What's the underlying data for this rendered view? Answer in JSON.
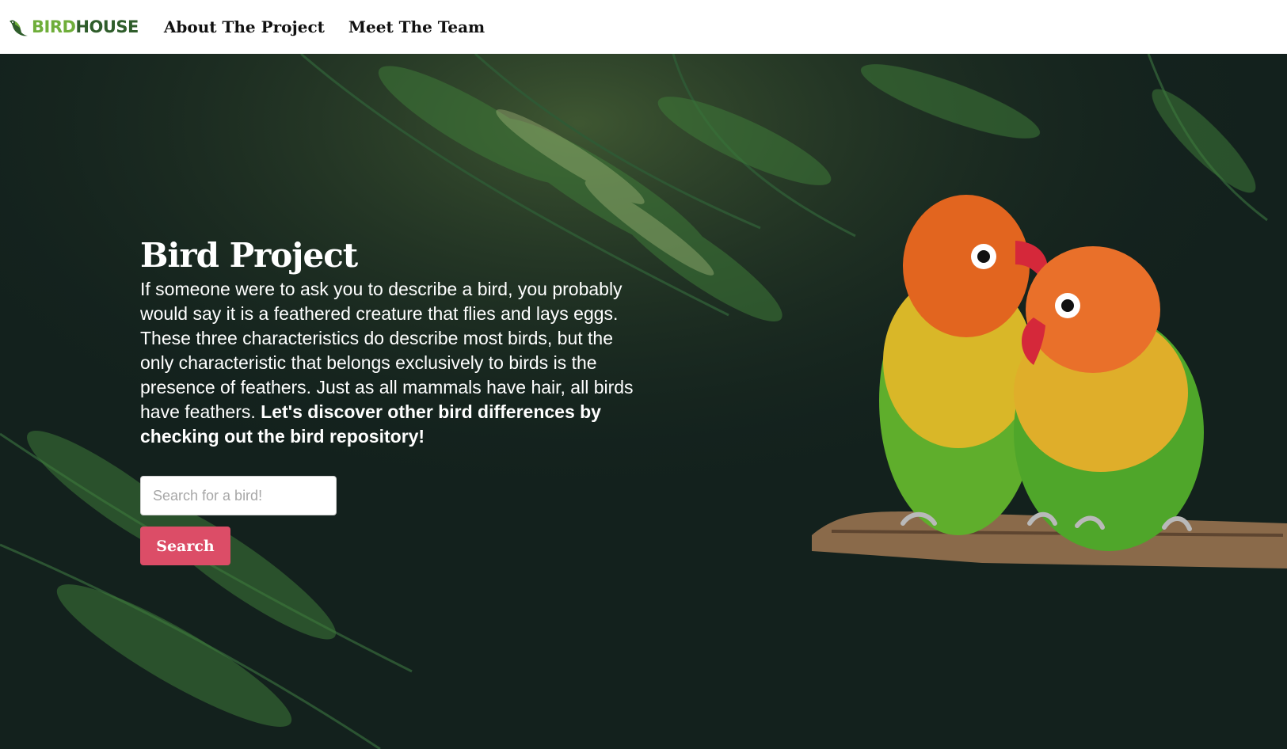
{
  "navbar": {
    "logo_bird": "BIRD",
    "logo_house": "HOUSE",
    "links": [
      "About The Project",
      "Meet The Team"
    ]
  },
  "hero": {
    "title": "Bird Project",
    "description": "If someone were to ask you to describe a bird, you probably would say it is a feathered creature that flies and lays eggs. These three characteristics do describe most birds, but the only characteristic that belongs exclusively to birds is the presence of feathers. Just as all mammals have hair, all birds have feathers.",
    "description_bold": "Let's discover other bird differences by checking out the bird repository!"
  },
  "search": {
    "placeholder": "Search for a bird!",
    "value": "",
    "button_label": "Search"
  },
  "colors": {
    "logo_bird": "#6fae3a",
    "logo_house": "#2f5d2b",
    "search_button": "#dc4d67",
    "hero_background": "#13201c"
  },
  "icons": {
    "logo": "green-bird-logo-icon"
  }
}
